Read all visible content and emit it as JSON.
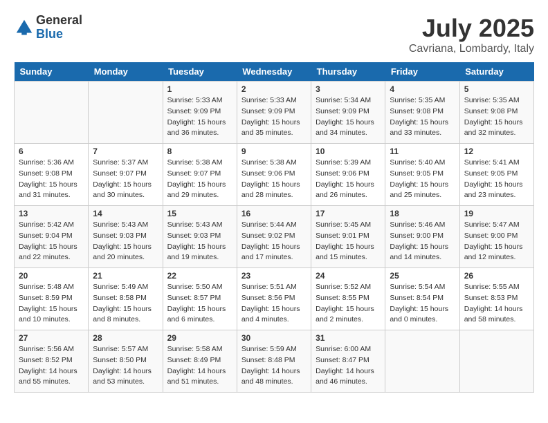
{
  "logo": {
    "general": "General",
    "blue": "Blue"
  },
  "title": "July 2025",
  "subtitle": "Cavriana, Lombardy, Italy",
  "days_header": [
    "Sunday",
    "Monday",
    "Tuesday",
    "Wednesday",
    "Thursday",
    "Friday",
    "Saturday"
  ],
  "weeks": [
    [
      {
        "day": "",
        "sunrise": "",
        "sunset": "",
        "daylight": ""
      },
      {
        "day": "",
        "sunrise": "",
        "sunset": "",
        "daylight": ""
      },
      {
        "day": "1",
        "sunrise": "Sunrise: 5:33 AM",
        "sunset": "Sunset: 9:09 PM",
        "daylight": "Daylight: 15 hours and 36 minutes."
      },
      {
        "day": "2",
        "sunrise": "Sunrise: 5:33 AM",
        "sunset": "Sunset: 9:09 PM",
        "daylight": "Daylight: 15 hours and 35 minutes."
      },
      {
        "day": "3",
        "sunrise": "Sunrise: 5:34 AM",
        "sunset": "Sunset: 9:09 PM",
        "daylight": "Daylight: 15 hours and 34 minutes."
      },
      {
        "day": "4",
        "sunrise": "Sunrise: 5:35 AM",
        "sunset": "Sunset: 9:08 PM",
        "daylight": "Daylight: 15 hours and 33 minutes."
      },
      {
        "day": "5",
        "sunrise": "Sunrise: 5:35 AM",
        "sunset": "Sunset: 9:08 PM",
        "daylight": "Daylight: 15 hours and 32 minutes."
      }
    ],
    [
      {
        "day": "6",
        "sunrise": "Sunrise: 5:36 AM",
        "sunset": "Sunset: 9:08 PM",
        "daylight": "Daylight: 15 hours and 31 minutes."
      },
      {
        "day": "7",
        "sunrise": "Sunrise: 5:37 AM",
        "sunset": "Sunset: 9:07 PM",
        "daylight": "Daylight: 15 hours and 30 minutes."
      },
      {
        "day": "8",
        "sunrise": "Sunrise: 5:38 AM",
        "sunset": "Sunset: 9:07 PM",
        "daylight": "Daylight: 15 hours and 29 minutes."
      },
      {
        "day": "9",
        "sunrise": "Sunrise: 5:38 AM",
        "sunset": "Sunset: 9:06 PM",
        "daylight": "Daylight: 15 hours and 28 minutes."
      },
      {
        "day": "10",
        "sunrise": "Sunrise: 5:39 AM",
        "sunset": "Sunset: 9:06 PM",
        "daylight": "Daylight: 15 hours and 26 minutes."
      },
      {
        "day": "11",
        "sunrise": "Sunrise: 5:40 AM",
        "sunset": "Sunset: 9:05 PM",
        "daylight": "Daylight: 15 hours and 25 minutes."
      },
      {
        "day": "12",
        "sunrise": "Sunrise: 5:41 AM",
        "sunset": "Sunset: 9:05 PM",
        "daylight": "Daylight: 15 hours and 23 minutes."
      }
    ],
    [
      {
        "day": "13",
        "sunrise": "Sunrise: 5:42 AM",
        "sunset": "Sunset: 9:04 PM",
        "daylight": "Daylight: 15 hours and 22 minutes."
      },
      {
        "day": "14",
        "sunrise": "Sunrise: 5:43 AM",
        "sunset": "Sunset: 9:03 PM",
        "daylight": "Daylight: 15 hours and 20 minutes."
      },
      {
        "day": "15",
        "sunrise": "Sunrise: 5:43 AM",
        "sunset": "Sunset: 9:03 PM",
        "daylight": "Daylight: 15 hours and 19 minutes."
      },
      {
        "day": "16",
        "sunrise": "Sunrise: 5:44 AM",
        "sunset": "Sunset: 9:02 PM",
        "daylight": "Daylight: 15 hours and 17 minutes."
      },
      {
        "day": "17",
        "sunrise": "Sunrise: 5:45 AM",
        "sunset": "Sunset: 9:01 PM",
        "daylight": "Daylight: 15 hours and 15 minutes."
      },
      {
        "day": "18",
        "sunrise": "Sunrise: 5:46 AM",
        "sunset": "Sunset: 9:00 PM",
        "daylight": "Daylight: 15 hours and 14 minutes."
      },
      {
        "day": "19",
        "sunrise": "Sunrise: 5:47 AM",
        "sunset": "Sunset: 9:00 PM",
        "daylight": "Daylight: 15 hours and 12 minutes."
      }
    ],
    [
      {
        "day": "20",
        "sunrise": "Sunrise: 5:48 AM",
        "sunset": "Sunset: 8:59 PM",
        "daylight": "Daylight: 15 hours and 10 minutes."
      },
      {
        "day": "21",
        "sunrise": "Sunrise: 5:49 AM",
        "sunset": "Sunset: 8:58 PM",
        "daylight": "Daylight: 15 hours and 8 minutes."
      },
      {
        "day": "22",
        "sunrise": "Sunrise: 5:50 AM",
        "sunset": "Sunset: 8:57 PM",
        "daylight": "Daylight: 15 hours and 6 minutes."
      },
      {
        "day": "23",
        "sunrise": "Sunrise: 5:51 AM",
        "sunset": "Sunset: 8:56 PM",
        "daylight": "Daylight: 15 hours and 4 minutes."
      },
      {
        "day": "24",
        "sunrise": "Sunrise: 5:52 AM",
        "sunset": "Sunset: 8:55 PM",
        "daylight": "Daylight: 15 hours and 2 minutes."
      },
      {
        "day": "25",
        "sunrise": "Sunrise: 5:54 AM",
        "sunset": "Sunset: 8:54 PM",
        "daylight": "Daylight: 15 hours and 0 minutes."
      },
      {
        "day": "26",
        "sunrise": "Sunrise: 5:55 AM",
        "sunset": "Sunset: 8:53 PM",
        "daylight": "Daylight: 14 hours and 58 minutes."
      }
    ],
    [
      {
        "day": "27",
        "sunrise": "Sunrise: 5:56 AM",
        "sunset": "Sunset: 8:52 PM",
        "daylight": "Daylight: 14 hours and 55 minutes."
      },
      {
        "day": "28",
        "sunrise": "Sunrise: 5:57 AM",
        "sunset": "Sunset: 8:50 PM",
        "daylight": "Daylight: 14 hours and 53 minutes."
      },
      {
        "day": "29",
        "sunrise": "Sunrise: 5:58 AM",
        "sunset": "Sunset: 8:49 PM",
        "daylight": "Daylight: 14 hours and 51 minutes."
      },
      {
        "day": "30",
        "sunrise": "Sunrise: 5:59 AM",
        "sunset": "Sunset: 8:48 PM",
        "daylight": "Daylight: 14 hours and 48 minutes."
      },
      {
        "day": "31",
        "sunrise": "Sunrise: 6:00 AM",
        "sunset": "Sunset: 8:47 PM",
        "daylight": "Daylight: 14 hours and 46 minutes."
      },
      {
        "day": "",
        "sunrise": "",
        "sunset": "",
        "daylight": ""
      },
      {
        "day": "",
        "sunrise": "",
        "sunset": "",
        "daylight": ""
      }
    ]
  ]
}
